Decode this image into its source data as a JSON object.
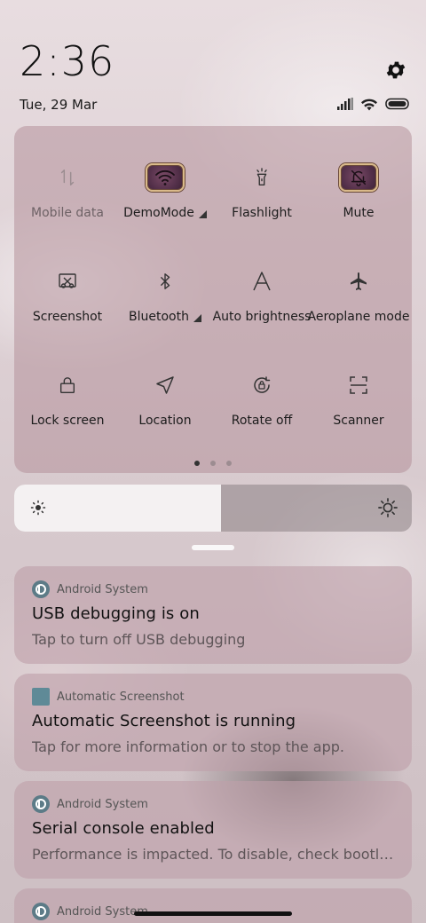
{
  "status_bar": {
    "time": "2:36",
    "date": "Tue, 29 Mar",
    "icons": [
      "signal-icon",
      "wifi-icon",
      "battery-icon"
    ]
  },
  "quick_settings": {
    "tiles": [
      {
        "label": "Mobile data",
        "icon": "mobile-data-icon",
        "active": false,
        "dim": true
      },
      {
        "label": "DemoMode",
        "icon": "wifi-icon",
        "active": true,
        "has_dropdown": true
      },
      {
        "label": "Flashlight",
        "icon": "flashlight-icon",
        "active": false
      },
      {
        "label": "Mute",
        "icon": "bell-off-icon",
        "active": true
      },
      {
        "label": "Screenshot",
        "icon": "screenshot-icon",
        "active": false
      },
      {
        "label": "Bluetooth",
        "icon": "bluetooth-icon",
        "active": false,
        "has_dropdown": true
      },
      {
        "label": "Auto brightness",
        "icon": "auto-brightness-icon",
        "active": false
      },
      {
        "label": "Aeroplane mode",
        "icon": "airplane-icon",
        "active": false
      },
      {
        "label": "Lock screen",
        "icon": "lock-icon",
        "active": false
      },
      {
        "label": "Location",
        "icon": "location-icon",
        "active": false
      },
      {
        "label": "Rotate off",
        "icon": "rotate-lock-icon",
        "active": false
      },
      {
        "label": "Scanner",
        "icon": "scanner-icon",
        "active": false
      }
    ],
    "pages": 3,
    "current_page": 1
  },
  "brightness": {
    "level_fraction": 0.52
  },
  "notifications": [
    {
      "app": "Android System",
      "app_icon": "android-system-icon",
      "title": "USB debugging is on",
      "text": "Tap to turn off USB debugging"
    },
    {
      "app": "Automatic Screenshot",
      "app_icon": "automatic-screenshot-icon",
      "title": "Automatic Screenshot is running",
      "text": "Tap for more information or to stop the app."
    },
    {
      "app": "Android System",
      "app_icon": "android-system-icon",
      "title": "Serial console enabled",
      "text": "Performance is impacted. To disable, check bootloader."
    },
    {
      "app": "Android System",
      "app_icon": "android-system-icon",
      "title": "",
      "text": ""
    }
  ],
  "colors": {
    "panel": "#b4919b",
    "active_tile": "#54304a",
    "active_tile_border": "#d9b98a"
  }
}
